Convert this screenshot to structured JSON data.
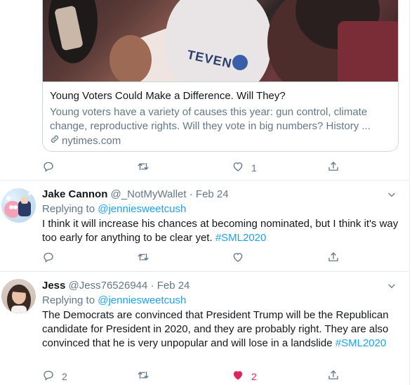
{
  "card": {
    "title": "Young Voters Could Make a Difference. Will They?",
    "description": "Young voters have a variety of causes this year: gun control, climate change, reproductive rights. Will they vote in big numbers? History ...",
    "domain": "nytimes.com",
    "image_text": "TEVEN"
  },
  "main_tweet_actions": {
    "reply_count": "",
    "retweet_count": "",
    "like_count": "1"
  },
  "replies": [
    {
      "name": "Jake Cannon",
      "handle": "@_NotMyWallet",
      "date": "Feb 24",
      "replying_prefix": "Replying to ",
      "replying_to": "@jenniesweetcush",
      "text": "I think it will increase his chances at becoming nominated, but I think it's way too early for anything to be clear yet. ",
      "hashtag": "#SML2020",
      "reply_count": "",
      "retweet_count": "",
      "like_count": "",
      "liked": false
    },
    {
      "name": "Jess",
      "handle": "@Jess76526944",
      "date": "Feb 24",
      "replying_prefix": "Replying to ",
      "replying_to": "@jenniesweetcush",
      "text": "The Democrats are convinced that President Trump will be the Republican candidate for President in 2020, and they are probably right. They are also convinced that he is very unpopular and will lose in a landslide ",
      "hashtag": "#SML2020",
      "reply_count": "2",
      "retweet_count": "",
      "like_count": "2",
      "liked": true
    }
  ],
  "colors": {
    "accent": "#1da1f2",
    "secondary_text": "#657786",
    "like_red": "#e0245e",
    "border": "#e6ecf0"
  }
}
